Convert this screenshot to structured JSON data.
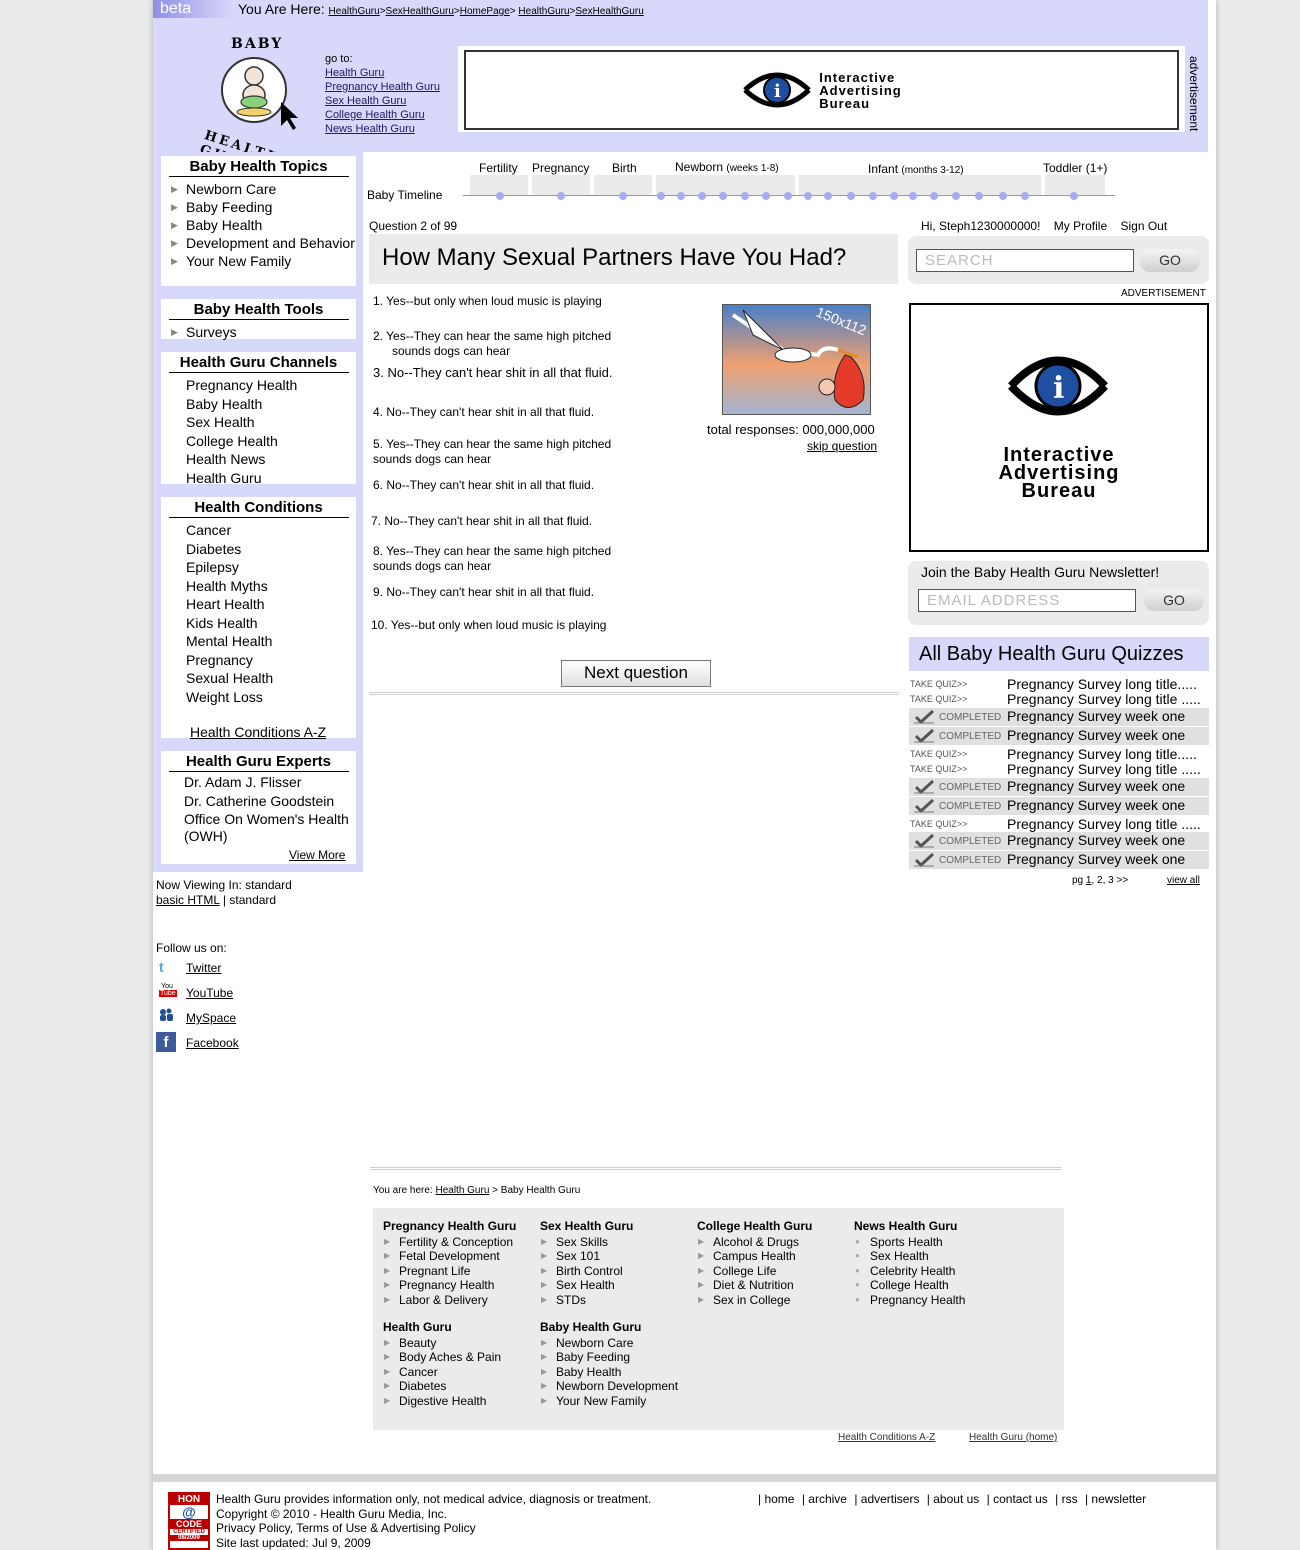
{
  "topbar": {
    "beta": "beta",
    "you_are_here": "You Are Here:",
    "crumbs": [
      "HealthGuru",
      "SexHealthGuru",
      "HomePage",
      "HealthGuru",
      "SexHealthGuru"
    ],
    "seps": [
      ">",
      ">",
      ">",
      ">"
    ]
  },
  "header": {
    "logo_top": "BABY",
    "logo_bottom": "HEALTH GURU",
    "goto_label": "go to:",
    "goto_links": [
      "Health Guru",
      "Pregnancy Health Guru",
      "Sex Health Guru",
      "College Health Guru",
      "News Health Guru"
    ],
    "ad_label": "advertisement",
    "ad_lines": [
      "Interactive",
      "Advertising",
      "Bureau"
    ]
  },
  "sidebar": {
    "topics": {
      "title": "Baby Health Topics",
      "items": [
        "Newborn Care",
        "Baby Feeding",
        "Baby Health",
        "Development and Behavior",
        "Your New Family"
      ]
    },
    "tools": {
      "title": "Baby Health Tools",
      "items": [
        "Surveys"
      ]
    },
    "channels": {
      "title": "Health Guru Channels",
      "items": [
        "Pregnancy Health",
        "Baby Health",
        "Sex Health",
        "College Health",
        "Health News",
        "Health Guru"
      ]
    },
    "conditions": {
      "title": "Health Conditions",
      "items": [
        "Cancer",
        "Diabetes",
        "Epilepsy",
        "Health Myths",
        "Heart Health",
        "Kids Health",
        "Mental Health",
        "Pregnancy",
        "Sexual Health",
        "Weight Loss"
      ],
      "az_link": "Health Conditions A-Z"
    },
    "experts": {
      "title": "Health Guru Experts",
      "items": [
        "Dr. Adam J. Flisser",
        "Dr. Catherine Goodstein",
        "Office On Women's Health (OWH)"
      ],
      "view_more": "View More"
    },
    "viewing": {
      "label": "Now Viewing In: standard",
      "basic": "basic HTML",
      "sep": "|",
      "standard": "standard"
    },
    "follow": {
      "label": "Follow us on:",
      "links": [
        "Twitter",
        "YouTube",
        "MySpace",
        "Facebook"
      ]
    }
  },
  "timeline": {
    "label": "Baby Timeline",
    "stages": [
      {
        "name": "Fertility",
        "sub": ""
      },
      {
        "name": "Pregnancy",
        "sub": ""
      },
      {
        "name": "Birth",
        "sub": ""
      },
      {
        "name": "Newborn",
        "sub": "(weeks 1-8)"
      },
      {
        "name": "Infant",
        "sub": "(months 3-12)"
      },
      {
        "name": "Toddler (1+)",
        "sub": ""
      }
    ]
  },
  "quiz": {
    "counter": "Question 2 of 99",
    "question": "How Many Sexual Partners Have You Had?",
    "answers": [
      "1. Yes--but only when loud music is playing",
      "2. Yes--They can hear the same high pitched",
      "sounds dogs can hear",
      "3. No--They can't hear shit in all that fluid.",
      "4. No--They can't hear shit in all that fluid.",
      "5. Yes--They can hear the same high pitched",
      "sounds dogs can hear",
      "6. No--They can't hear shit in all that fluid.",
      "7. No--They can't hear shit in all that fluid.",
      "8. Yes--They can hear the same high pitched",
      "sounds dogs can hear",
      "9. No--They can't hear shit in all that fluid.",
      "10. Yes--but only when loud music is playing"
    ],
    "image_label": "150x112",
    "responses_label": "total responses:",
    "responses_value": "000,000,000",
    "skip": "skip question",
    "next": "Next question"
  },
  "user": {
    "greeting": "Hi, Steph1230000000!",
    "profile": "My Profile",
    "signout": "Sign Out"
  },
  "search": {
    "placeholder": "SEARCH",
    "go": "GO"
  },
  "ad_right": {
    "label": "ADVERTISEMENT",
    "lines": [
      "Interactive",
      "Advertising",
      "Bureau"
    ]
  },
  "newsletter": {
    "title": "Join the Baby Health Guru Newsletter!",
    "placeholder": "EMAIL ADDRESS",
    "go": "GO"
  },
  "quizzes": {
    "title": "All Baby Health Guru Quizzes",
    "take": "TAKE QUIZ>>",
    "completed": "COMPLETED",
    "rows": [
      {
        "status": "take",
        "title": "Pregnancy Survey long title....."
      },
      {
        "status": "take",
        "title": "Pregnancy Survey long title ....."
      },
      {
        "status": "done",
        "title": "Pregnancy Survey week one"
      },
      {
        "status": "done",
        "title": "Pregnancy Survey week one"
      },
      {
        "status": "take",
        "title": "Pregnancy Survey long title....."
      },
      {
        "status": "take",
        "title": "Pregnancy Survey long title ....."
      },
      {
        "status": "done",
        "title": "Pregnancy Survey week one"
      },
      {
        "status": "done",
        "title": "Pregnancy Survey week one"
      },
      {
        "status": "take",
        "title": "Pregnancy Survey long title ....."
      },
      {
        "status": "done",
        "title": "Pregnancy Survey week one"
      },
      {
        "status": "done",
        "title": "Pregnancy Survey week one"
      }
    ],
    "pg_label": "pg",
    "pages": [
      "1",
      "2",
      "3"
    ],
    "next": ">>",
    "view_all": "view all"
  },
  "footer": {
    "you_are_here": "You are here:",
    "crumb_link": "Health Guru",
    "crumb_rest": "> Baby Health Guru",
    "columns": [
      {
        "title": "Pregnancy Health Guru",
        "items": [
          "Fertility & Conception",
          "Fetal Development",
          "Pregnant Life",
          "Pregnancy Health",
          "Labor & Delivery"
        ]
      },
      {
        "title": "Sex Health Guru",
        "items": [
          "Sex Skills",
          "Sex 101",
          "Birth Control",
          "Sex Health",
          "STDs"
        ]
      },
      {
        "title": "College Health Guru",
        "items": [
          "Alcohol & Drugs",
          "Campus Health",
          "College Life",
          "Diet & Nutrition",
          "Sex in College"
        ]
      },
      {
        "title": "News Health Guru",
        "items": [
          "Sports Health",
          "Sex Health",
          "Celebrity Health",
          "College Health",
          "Pregnancy Health"
        ]
      },
      {
        "title": "Health Guru",
        "items": [
          "Beauty",
          "Body Aches & Pain",
          "Cancer",
          "Diabetes",
          "Digestive Health"
        ]
      },
      {
        "title": "Baby Health Guru",
        "items": [
          "Newborn Care",
          "Baby Feeding",
          "Baby Health",
          "Newborn Development",
          "Your New Family"
        ]
      }
    ],
    "az": "Health Conditions A-Z",
    "home": "Health Guru (home)",
    "disclaimer": "Health Guru provides information only, not medical advice, diagnosis or treatment.",
    "copyright": "Copyright © 2010 - Health Guru Media, Inc.",
    "policy": "Privacy Policy, Terms of Use & Advertising Policy",
    "updated": "Site last updated: Jul 9, 2009",
    "hon": [
      "HON",
      "CODE",
      "CERTIFIED",
      "08/2009"
    ],
    "nav": [
      "home",
      "archive",
      "advertisers",
      "about us",
      "contact us",
      "rss",
      "newsletter"
    ]
  }
}
